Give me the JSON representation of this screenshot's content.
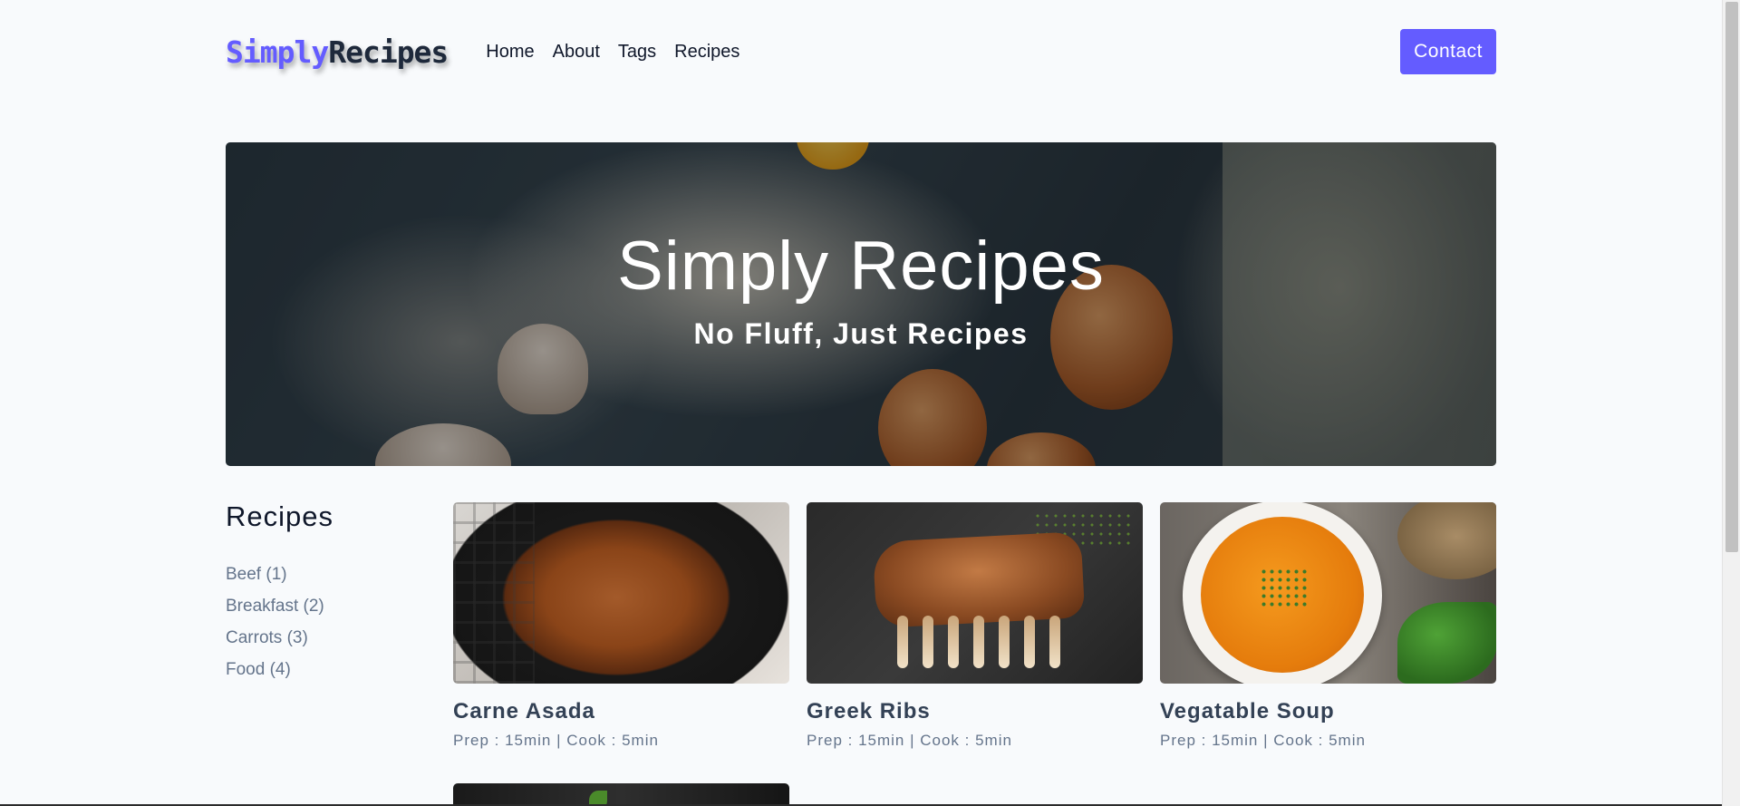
{
  "nav": {
    "logo_part1": "Simply",
    "logo_part2": "Recipes",
    "links": [
      "Home",
      "About",
      "Tags",
      "Recipes"
    ],
    "contact_label": "Contact"
  },
  "hero": {
    "title": "Simply Recipes",
    "subtitle": "No Fluff, Just Recipes"
  },
  "sidebar": {
    "title": "Recipes",
    "tags": [
      "Beef (1)",
      "Breakfast (2)",
      "Carrots (3)",
      "Food (4)"
    ]
  },
  "recipes": [
    {
      "title": "Carne Asada",
      "meta": "Prep : 15min | Cook : 5min"
    },
    {
      "title": "Greek Ribs",
      "meta": "Prep : 15min | Cook : 5min"
    },
    {
      "title": "Vegatable Soup",
      "meta": "Prep : 15min | Cook : 5min"
    }
  ],
  "colors": {
    "accent": "#645cff",
    "text": "#0f172a",
    "muted": "#64748b",
    "background": "#f8fafc"
  }
}
